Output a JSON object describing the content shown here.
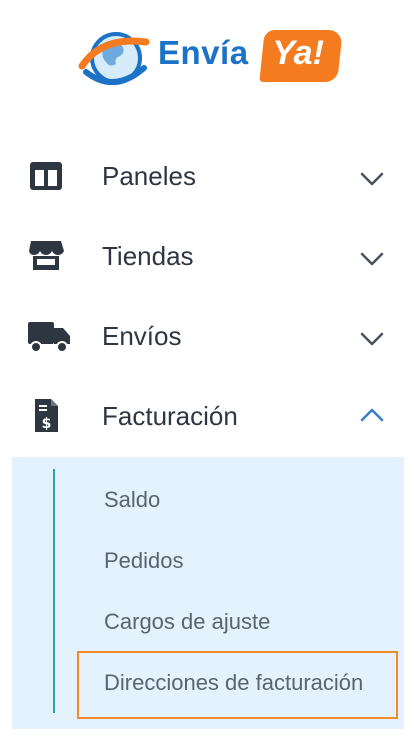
{
  "brand": {
    "name_part1": "Envía",
    "name_part2": "Ya!"
  },
  "nav": {
    "items": [
      {
        "label": "Paneles",
        "icon": "dashboard-panels-icon",
        "expanded": false
      },
      {
        "label": "Tiendas",
        "icon": "store-icon",
        "expanded": false
      },
      {
        "label": "Envíos",
        "icon": "truck-icon",
        "expanded": false
      },
      {
        "label": "Facturación",
        "icon": "invoice-dollar-icon",
        "expanded": true
      }
    ],
    "billing_submenu": [
      {
        "label": "Saldo"
      },
      {
        "label": "Pedidos"
      },
      {
        "label": "Cargos de ajuste"
      },
      {
        "label": "Direcciones de facturación",
        "active": true
      }
    ]
  },
  "colors": {
    "brand_blue": "#1c72c6",
    "brand_orange": "#f47b20",
    "submenu_bg": "#e3f2fd",
    "active_border": "#f28a2a",
    "expanded_chevron": "#3a7bd5"
  }
}
